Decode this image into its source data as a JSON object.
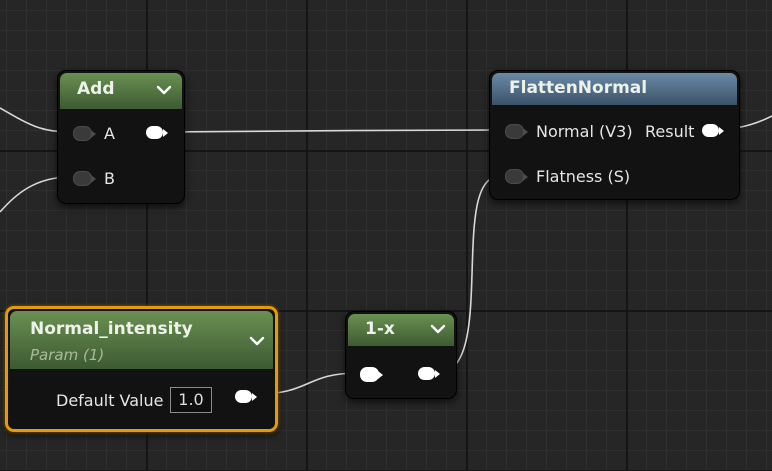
{
  "colors": {
    "canvas_background": "#262626",
    "header_green": "#4f7340",
    "header_blue": "#526d87",
    "selection_outline": "#e09c0c",
    "wire": "#d8d8d8"
  },
  "nodes": {
    "add": {
      "title": "Add",
      "inputs": [
        "A",
        "B"
      ]
    },
    "flatten_normal": {
      "title": "FlattenNormal",
      "inputs": [
        "Normal (V3)",
        "Flatness (S)"
      ],
      "output": "Result"
    },
    "normal_intensity": {
      "title": "Normal_intensity",
      "subtitle": "Param (1)",
      "default_value_label": "Default Value",
      "default_value": "1.0"
    },
    "one_minus": {
      "title": "1-x"
    }
  },
  "icons": {
    "collapse": "chevron-down-icon",
    "input_pin": "pin-input-icon",
    "output_pin": "pin-output-icon"
  }
}
